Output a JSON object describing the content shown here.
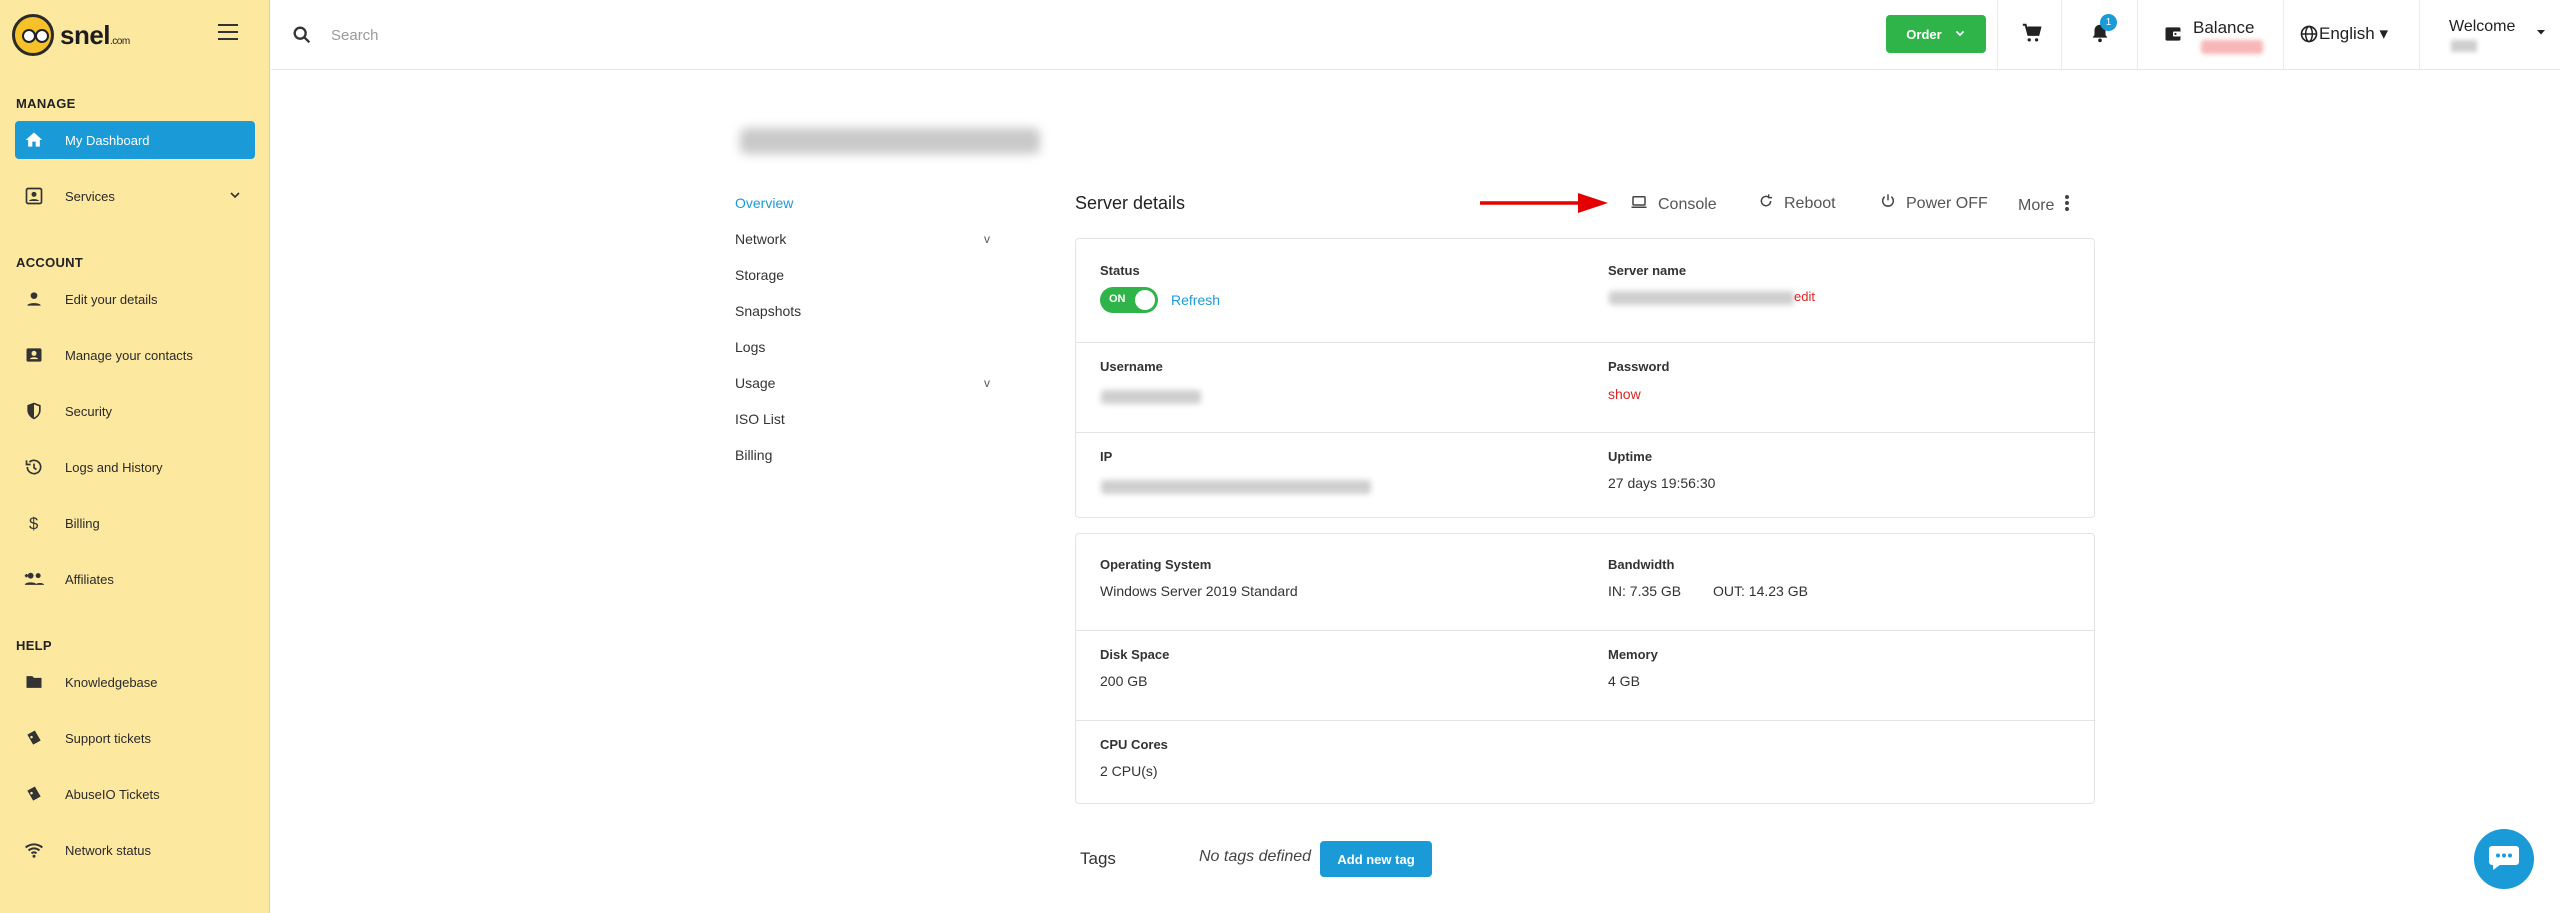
{
  "brand": {
    "name": "snel",
    "suffix": ".com"
  },
  "sidebar": {
    "sections": [
      "MANAGE",
      "ACCOUNT",
      "HELP"
    ],
    "items": [
      {
        "label": "My Dashboard",
        "icon": "home-icon",
        "active": true
      },
      {
        "label": "Services",
        "icon": "services-icon"
      },
      {
        "label": "Edit your details",
        "icon": "person-icon"
      },
      {
        "label": "Manage your contacts",
        "icon": "contacts-icon"
      },
      {
        "label": "Security",
        "icon": "shield-icon"
      },
      {
        "label": "Logs and History",
        "icon": "history-icon"
      },
      {
        "label": "Billing",
        "icon": "dollar-icon"
      },
      {
        "label": "Affiliates",
        "icon": "group-icon"
      },
      {
        "label": "Knowledgebase",
        "icon": "folder-icon"
      },
      {
        "label": "Support tickets",
        "icon": "ticket-icon"
      },
      {
        "label": "AbuseIO Tickets",
        "icon": "ticket-icon"
      },
      {
        "label": "Network status",
        "icon": "wifi-icon"
      }
    ]
  },
  "topbar": {
    "search_placeholder": "Search",
    "order_label": "Order",
    "notifications_count": "1",
    "balance_label": "Balance",
    "language": "English",
    "welcome": "Welcome"
  },
  "subnav": [
    "Overview",
    "Network",
    "Storage",
    "Snapshots",
    "Logs",
    "Usage",
    "ISO List",
    "Billing"
  ],
  "subnav_expand_glyph": "v",
  "server": {
    "title": "Server details",
    "actions": {
      "console": "Console",
      "reboot": "Reboot",
      "power": "Power OFF",
      "more": "More"
    },
    "status_label": "Status",
    "status_toggle": "ON",
    "refresh": "Refresh",
    "server_name_label": "Server name",
    "edit": "edit",
    "username_label": "Username",
    "password_label": "Password",
    "show": "show",
    "ip_label": "IP",
    "uptime_label": "Uptime",
    "uptime": "27 days 19:56:30",
    "os_label": "Operating System",
    "os": "Windows Server 2019 Standard",
    "bandwidth_label": "Bandwidth",
    "bw_in": "IN: 7.35 GB",
    "bw_out": "OUT: 14.23 GB",
    "disk_label": "Disk Space",
    "disk": "200 GB",
    "memory_label": "Memory",
    "memory": "4 GB",
    "cpu_label": "CPU Cores",
    "cpu": "2 CPU(s)"
  },
  "tags": {
    "label": "Tags",
    "empty": "No tags defined",
    "add": "Add new tag"
  },
  "colors": {
    "sidebar_bg": "#fde8a0",
    "accent": "#1a9ad6",
    "green": "#2fb44a",
    "red": "#e02424"
  }
}
